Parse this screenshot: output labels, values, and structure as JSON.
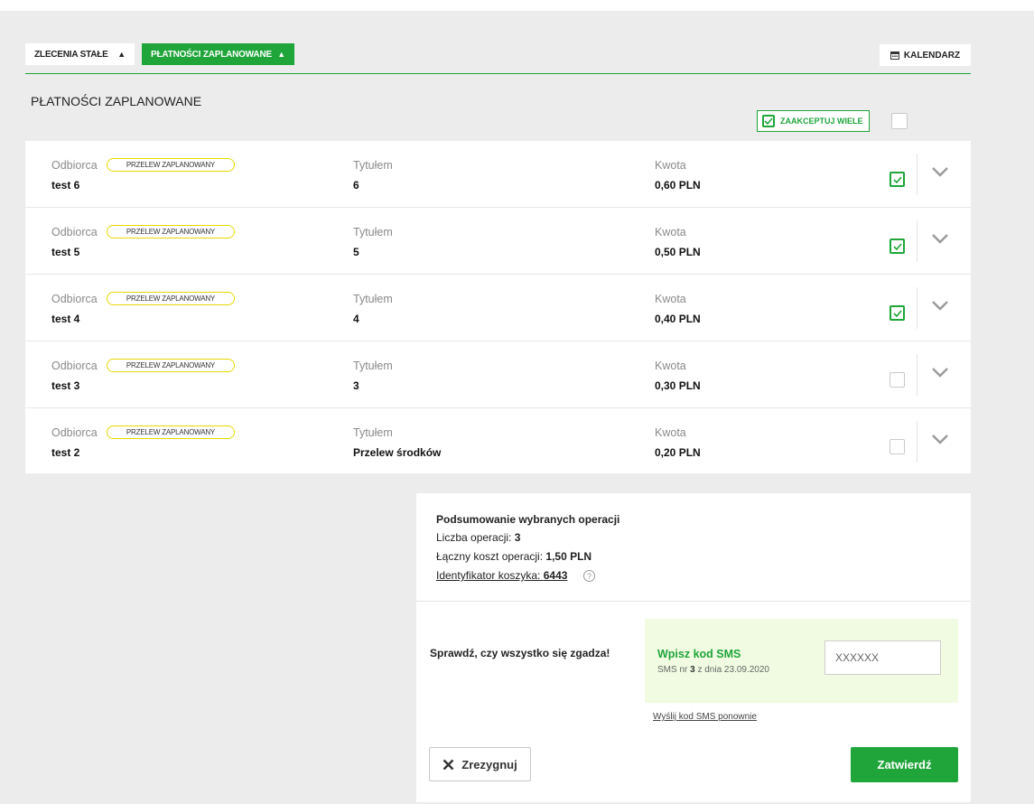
{
  "toolbar": {
    "standing_orders_label": "ZLECENIA STAŁE",
    "planned_payments_label": "PŁATNOŚCI ZAPLANOWANE",
    "calendar_label": "KALENDARZ"
  },
  "section": {
    "title": "PŁATNOŚCI ZAPLANOWANE",
    "accept_many_label": "ZAAKCEPTUJ WIELE",
    "select_all_checked": false
  },
  "columns": {
    "recipient_label": "Odbiorca",
    "title_label": "Tytułem",
    "amount_label": "Kwota"
  },
  "payments": [
    {
      "recipient": "test 6",
      "badge": "PRZELEW ZAPLANOWANY",
      "title": "6",
      "amount": "0,60 PLN",
      "checked": true
    },
    {
      "recipient": "test 5",
      "badge": "PRZELEW ZAPLANOWANY",
      "title": "5",
      "amount": "0,50 PLN",
      "checked": true
    },
    {
      "recipient": "test 4",
      "badge": "PRZELEW ZAPLANOWANY",
      "title": "4",
      "amount": "0,40 PLN",
      "checked": true
    },
    {
      "recipient": "test 3",
      "badge": "PRZELEW ZAPLANOWANY",
      "title": "3",
      "amount": "0,30 PLN",
      "checked": false
    },
    {
      "recipient": "test 2",
      "badge": "PRZELEW ZAPLANOWANY",
      "title": "Przelew środków",
      "amount": "0,20 PLN",
      "checked": false
    }
  ],
  "summary": {
    "title": "Podsumowanie wybranych operacji",
    "count_label": "Liczba operacji: ",
    "count_value": "3",
    "cost_label": "Łączny koszt operacji: ",
    "cost_value": "1,50 PLN",
    "basket_label": "Identyfikator koszyka: ",
    "basket_value": "6443",
    "help_icon": "?"
  },
  "confirm": {
    "check_message": "Sprawdź, czy wszystko się zgadza!",
    "sms_title": "Wpisz kod SMS",
    "sms_sub_prefix": "SMS nr ",
    "sms_number": "3",
    "sms_sub_suffix": " z dnia 23.09.2020",
    "sms_placeholder": "XXXXXX",
    "resend_label": "Wyślij kod SMS ponownie",
    "cancel_label": "Zrezygnuj",
    "submit_label": "Zatwierdź"
  },
  "colors": {
    "accent": "#1fa53a",
    "badge_border": "#e8d800",
    "sms_box_bg": "#f1fbe2",
    "page_bg": "#ececec"
  }
}
